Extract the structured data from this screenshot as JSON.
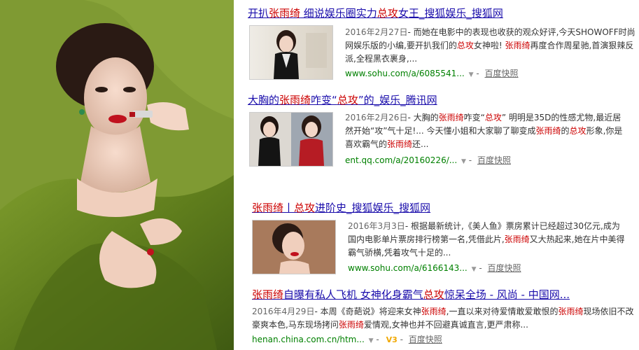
{
  "results": [
    {
      "title": [
        "开扒",
        "张雨绮",
        " 细说娱乐圈实力",
        "总攻",
        "女王_搜狐娱乐_搜狐网"
      ],
      "date": "2016年2月27日",
      "abstract": [
        "- 而她在电影中的表现也收获的观众好评,今天SHOWOFF时尚网娱乐版的小编,要开扒我们的",
        "总攻",
        "女神啦! ",
        "张雨绮",
        "再度合作周星驰,首演狠辣反派,全程黑衣裹身,..."
      ],
      "url": "www.sohu.com/a/6085541...",
      "cache": "百度快照"
    },
    {
      "title": [
        "大胸的",
        "张雨绮",
        "咋变“",
        "总攻",
        "”的_娱乐_腾讯网"
      ],
      "date": "2016年2月26日",
      "abstract": [
        "- 大胸的",
        "张雨绮",
        "咋变“",
        "总攻",
        "” 明明是35D的性感尤物,最近居然开始“攻”气十足!... 今天懂小姐和大家聊了聊变成",
        "张雨绮",
        "的",
        "总攻",
        "形象,你是喜欢霸气的",
        "张雨绮",
        "还..."
      ],
      "url": "ent.qq.com/a/20160226/...",
      "cache": "百度快照"
    },
    {
      "title": [
        "张雨绮",
        "丨",
        "总攻",
        "进阶史_搜狐娱乐_搜狐网"
      ],
      "date": "2016年3月3日",
      "abstract": [
        "- 根据最新统计,《美人鱼》票房累计已经超过30亿元,成为国内电影单片票房排行榜第一名,凭借此片,",
        "张雨绮",
        "又大热起来,她在片中美得霸气骄横,凭着攻气十足的..."
      ],
      "url": "www.sohu.com/a/6166143...",
      "cache": "百度快照"
    },
    {
      "title": [
        "张雨绮",
        "自曝有私人飞机 女神化身霸气",
        "总攻",
        "惊呆全场 - 风尚 - 中国网..."
      ],
      "date": "2016年4月29日",
      "abstract": [
        "- 本周《奇葩说》将迎来女神",
        "张雨绮",
        ",一直以来对待爱情敢爱敢恨的",
        "张雨绮",
        "现场依旧不改豪爽本色,马东现场拷问",
        "张雨绮",
        "爱情观,女神也并不回避真诚直言,更严肃称..."
      ],
      "url": "henan.china.com.cn/htm...",
      "badge": "V3",
      "cache": "百度快照"
    }
  ],
  "colors": {
    "link": "#1a0dab",
    "highlight": "#c00",
    "url": "#008000",
    "text": "#333"
  }
}
